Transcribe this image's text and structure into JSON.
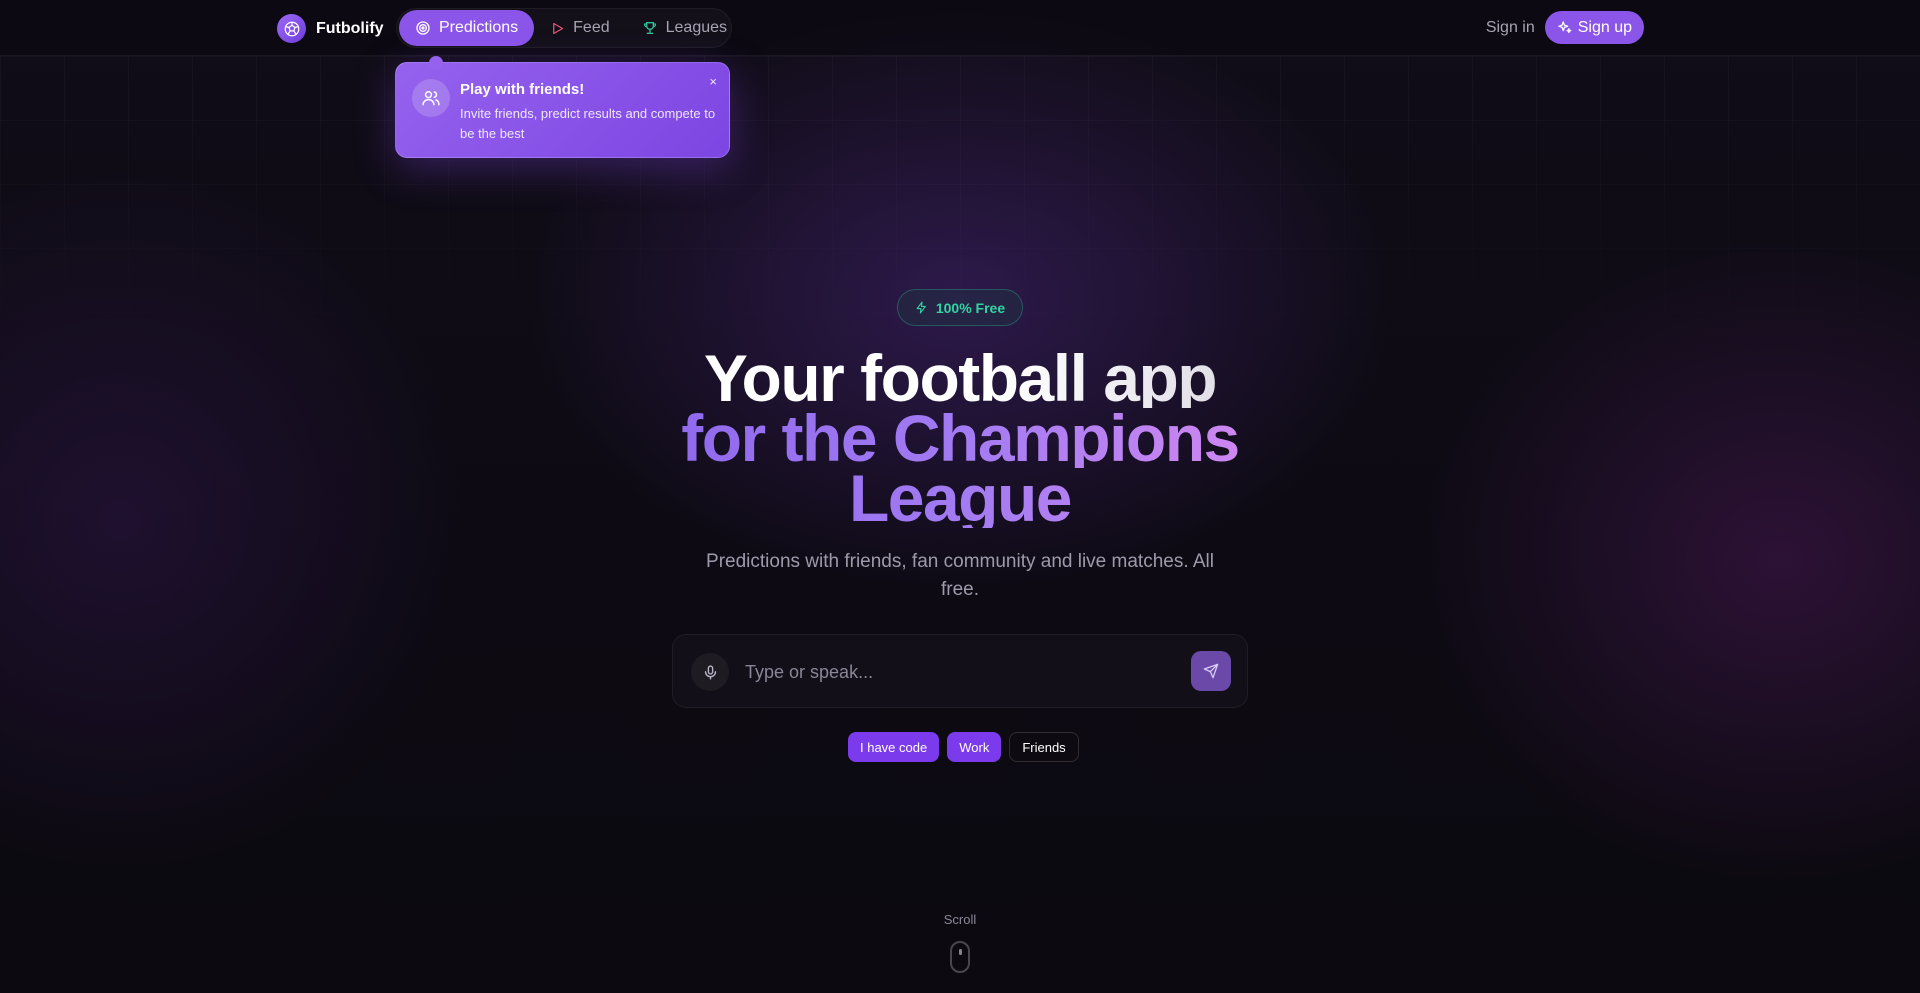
{
  "nav": {
    "brand": "Futbolify",
    "tabs": [
      {
        "label": "Predictions",
        "icon": "target-icon",
        "active": true
      },
      {
        "label": "Feed",
        "icon": "play-icon",
        "active": false
      },
      {
        "label": "Leagues",
        "icon": "trophy-icon",
        "active": false
      }
    ],
    "signin": "Sign in",
    "signup": "Sign up"
  },
  "tooltip": {
    "title": "Play with friends!",
    "body": "Invite friends, predict results and compete to be the best",
    "close": "×"
  },
  "hero": {
    "badge": "100% Free",
    "title_line1": "Your football app",
    "title_line2": "for the Champions",
    "title_line3": "League",
    "subtitle": "Predictions with friends, fan community and live matches. All free."
  },
  "prompt": {
    "placeholder": "Type or speak...",
    "value": ""
  },
  "chips": [
    {
      "label": "I have code",
      "style": "filled"
    },
    {
      "label": "Work",
      "style": "filled"
    },
    {
      "label": "Friends",
      "style": "outline"
    }
  ],
  "scroll_label": "Scroll",
  "colors": {
    "accent": "#8b55ea",
    "accent_dark": "#7c3aed",
    "badge_green": "#34d3a2",
    "background": "#0c0a10"
  }
}
